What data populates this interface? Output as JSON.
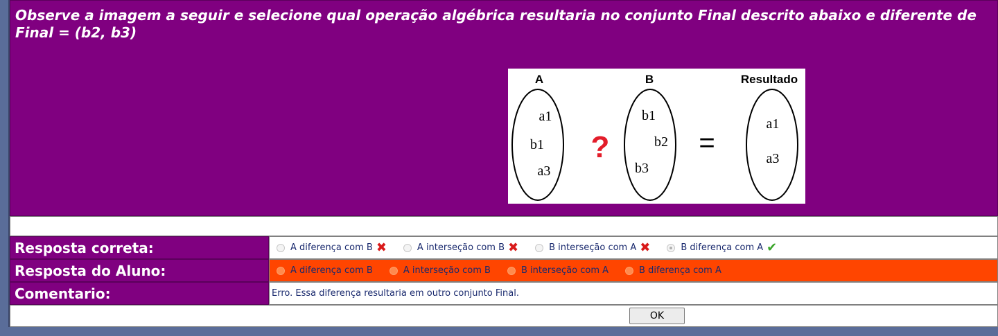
{
  "question": {
    "line1": "Observe a imagem a seguir e selecione qual operação algébrica resultaria no conjunto Final descrito abaixo e diferente de",
    "line2": "Final = (b2, b3)"
  },
  "figure": {
    "set_a": {
      "title": "A",
      "items": [
        "a1",
        "b1",
        "a3"
      ]
    },
    "operator": "?",
    "set_b": {
      "title": "B",
      "items": [
        "b1",
        "b2",
        "b3"
      ]
    },
    "equals": "=",
    "result": {
      "title": "Resultado",
      "items": [
        "a1",
        "a3"
      ]
    }
  },
  "correct_answer": {
    "label": "Resposta correta:",
    "options": [
      {
        "text": "A diferença com B",
        "mark": "x-icon",
        "selected": false
      },
      {
        "text": "A interseção com B",
        "mark": "x-icon",
        "selected": false
      },
      {
        "text": "B interseção com A",
        "mark": "x-icon",
        "selected": false
      },
      {
        "text": "B diferença com A",
        "mark": "check-icon",
        "selected": true
      }
    ]
  },
  "student_answer": {
    "label": "Resposta do Aluno:",
    "options": [
      {
        "text": "A diferença com B"
      },
      {
        "text": "A interseção com B"
      },
      {
        "text": "B interseção com A"
      },
      {
        "text": "B diferença com A"
      }
    ]
  },
  "comment": {
    "label": "Comentario:",
    "text": "Erro. Essa diferença resultaria em outro conjunto Final."
  },
  "ok_button": "OK",
  "colors": {
    "panel": "#800080",
    "student_row": "#ff4500",
    "background": "#5a6d99"
  }
}
